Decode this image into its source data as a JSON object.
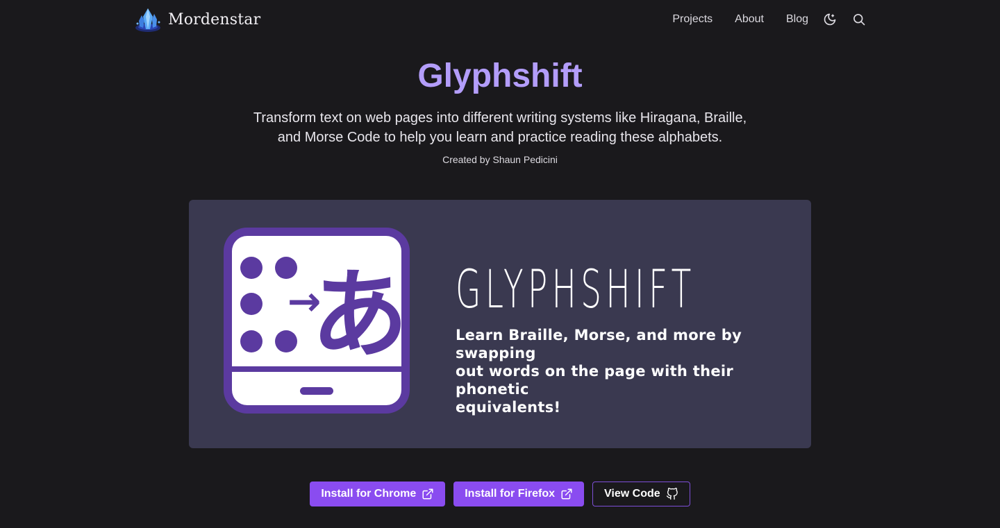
{
  "header": {
    "brand_name": "Mordenstar",
    "nav": [
      {
        "label": "Projects"
      },
      {
        "label": "About"
      },
      {
        "label": "Blog"
      }
    ],
    "icons": [
      "moon-icon",
      "search-icon"
    ]
  },
  "hero": {
    "title": "Glyphshift",
    "description_line1": "Transform text on web pages into different writing systems like Hiragana, Braille,",
    "description_line2": "and Morse Code to help you learn and practice reading these alphabets.",
    "credit": "Created by Shaun Pedicini"
  },
  "banner": {
    "wordmark": "GLYPHSHIFT",
    "tagline_line1": "Learn Braille, Morse, and more by swapping",
    "tagline_line2": "out words on the page with their phonetic",
    "tagline_line3": "equivalents!",
    "icon_glyph": "あ",
    "icon_arrow": "→"
  },
  "actions": {
    "chrome_label": "Install for Chrome",
    "firefox_label": "Install for Firefox",
    "code_label": "View Code"
  },
  "colors": {
    "background": "#1a191c",
    "accent": "#8a4cf0",
    "title": "#b39dfa",
    "banner": "#3a3950",
    "icon_purple": "#5b3aa0"
  }
}
